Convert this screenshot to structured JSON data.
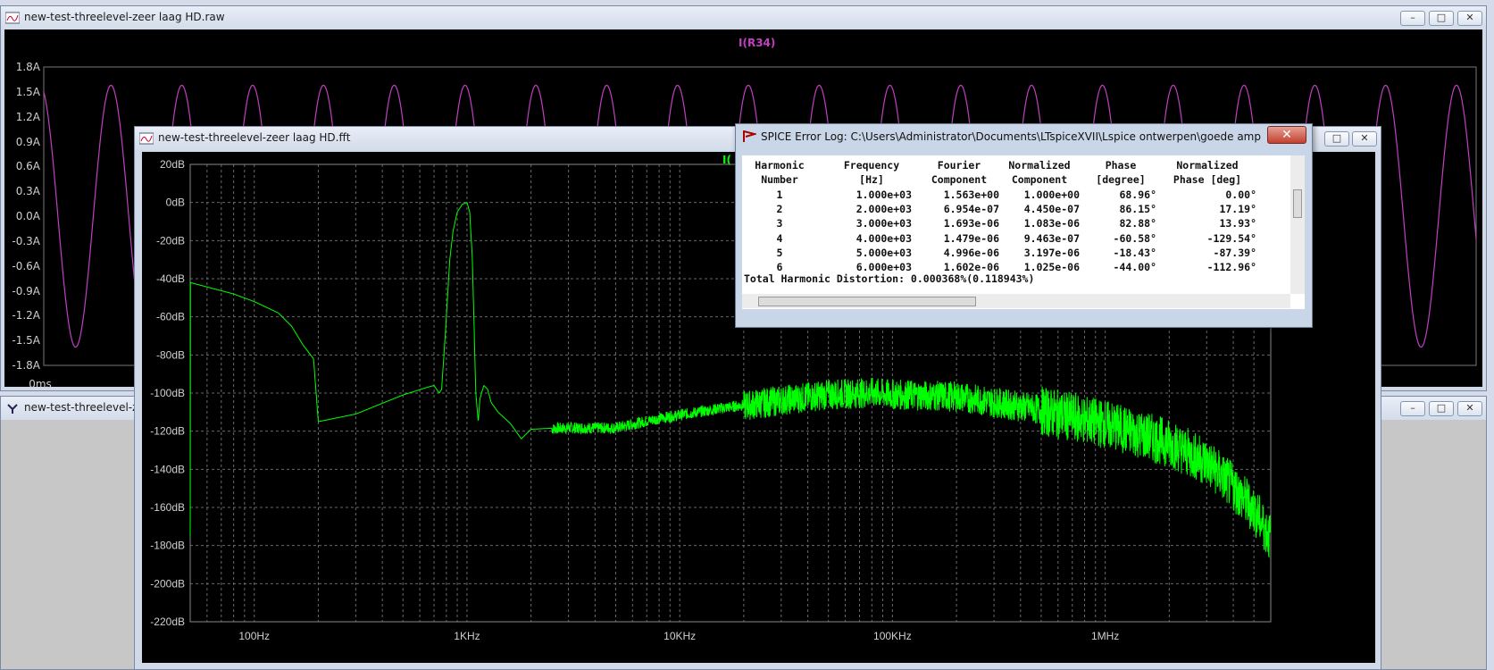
{
  "raw_window": {
    "title": "new-test-threelevel-zeer laag HD.raw",
    "trace_label": "I(R34)",
    "y_ticks": [
      "1.8A",
      "1.5A",
      "1.2A",
      "0.9A",
      "0.6A",
      "0.3A",
      "0.0A",
      "-0.3A",
      "-0.6A",
      "-0.9A",
      "-1.2A",
      "-1.5A",
      "-1.8A"
    ],
    "x_start": "0ms",
    "trace_color": "#c040c0"
  },
  "schematic_window": {
    "title": "new-test-threelevel-zeer"
  },
  "fft_window": {
    "title": "new-test-threelevel-zeer laag HD.fft",
    "trace_label_partial": "I(",
    "trace_color": "#00ff00"
  },
  "chart_data": {
    "type": "line",
    "x_scale": "log",
    "xlim": [
      50,
      6000000
    ],
    "ylim": [
      -220,
      20
    ],
    "x_ticks": [
      "100Hz",
      "1KHz",
      "10KHz",
      "100KHz",
      "1MHz"
    ],
    "y_ticks": [
      "20dB",
      "0dB",
      "-20dB",
      "-40dB",
      "-60dB",
      "-80dB",
      "-100dB",
      "-120dB",
      "-140dB",
      "-160dB",
      "-180dB",
      "-200dB",
      "-220dB"
    ],
    "grid": true,
    "series": [
      {
        "x": [
          50,
          80,
          100,
          130,
          150,
          170,
          190,
          200,
          300,
          500,
          650,
          700,
          740,
          760,
          790,
          830,
          860,
          900,
          950,
          1000,
          1030,
          1060,
          1100,
          1130,
          1150,
          1200,
          1250,
          1300,
          1400,
          1600,
          1800,
          2000,
          3000,
          5000,
          8000,
          15000,
          30000,
          50000,
          80000,
          100000,
          200000,
          300000,
          500000,
          1000000,
          2000000,
          3000000,
          4000000,
          5000000,
          6000000
        ],
        "y": [
          -42,
          -48,
          -52,
          -58,
          -65,
          -75,
          -82,
          -115,
          -111,
          -101,
          -97,
          -96,
          -100,
          -98,
          -70,
          -30,
          -15,
          -5,
          -1,
          0,
          -5,
          -30,
          -100,
          -115,
          -103,
          -96,
          -98,
          -105,
          -110,
          -116,
          -124,
          -119,
          -118,
          -118,
          -113,
          -108,
          -103,
          -100,
          -99,
          -100,
          -101,
          -104,
          -108,
          -115,
          -125,
          -135,
          -148,
          -160,
          -175
        ]
      }
    ]
  },
  "spice_log": {
    "title": "SPICE Error Log: C:\\Users\\Administrator\\Documents\\LTspiceXVII\\Lspice ontwerpen\\goede amps\\ideal mo...",
    "header1": [
      "Harmonic",
      "Frequency",
      "Fourier",
      "Normalized",
      "Phase",
      "Normalized"
    ],
    "header2": [
      "Number",
      "[Hz]",
      "Component",
      "Component",
      "[degree]",
      "Phase [deg]"
    ],
    "rows": [
      [
        "1",
        "1.000e+03",
        "1.563e+00",
        "1.000e+00",
        "68.96°",
        "0.00°"
      ],
      [
        "2",
        "2.000e+03",
        "6.954e-07",
        "4.450e-07",
        "86.15°",
        "17.19°"
      ],
      [
        "3",
        "3.000e+03",
        "1.693e-06",
        "1.083e-06",
        "82.88°",
        "13.93°"
      ],
      [
        "4",
        "4.000e+03",
        "1.479e-06",
        "9.463e-07",
        "-60.58°",
        "-129.54°"
      ],
      [
        "5",
        "5.000e+03",
        "4.996e-06",
        "3.197e-06",
        "-18.43°",
        "-87.39°"
      ],
      [
        "6",
        "6.000e+03",
        "1.602e-06",
        "1.025e-06",
        "-44.00°",
        "-112.96°"
      ]
    ],
    "thd": "Total Harmonic Distortion: 0.000368%(0.118943%)"
  }
}
